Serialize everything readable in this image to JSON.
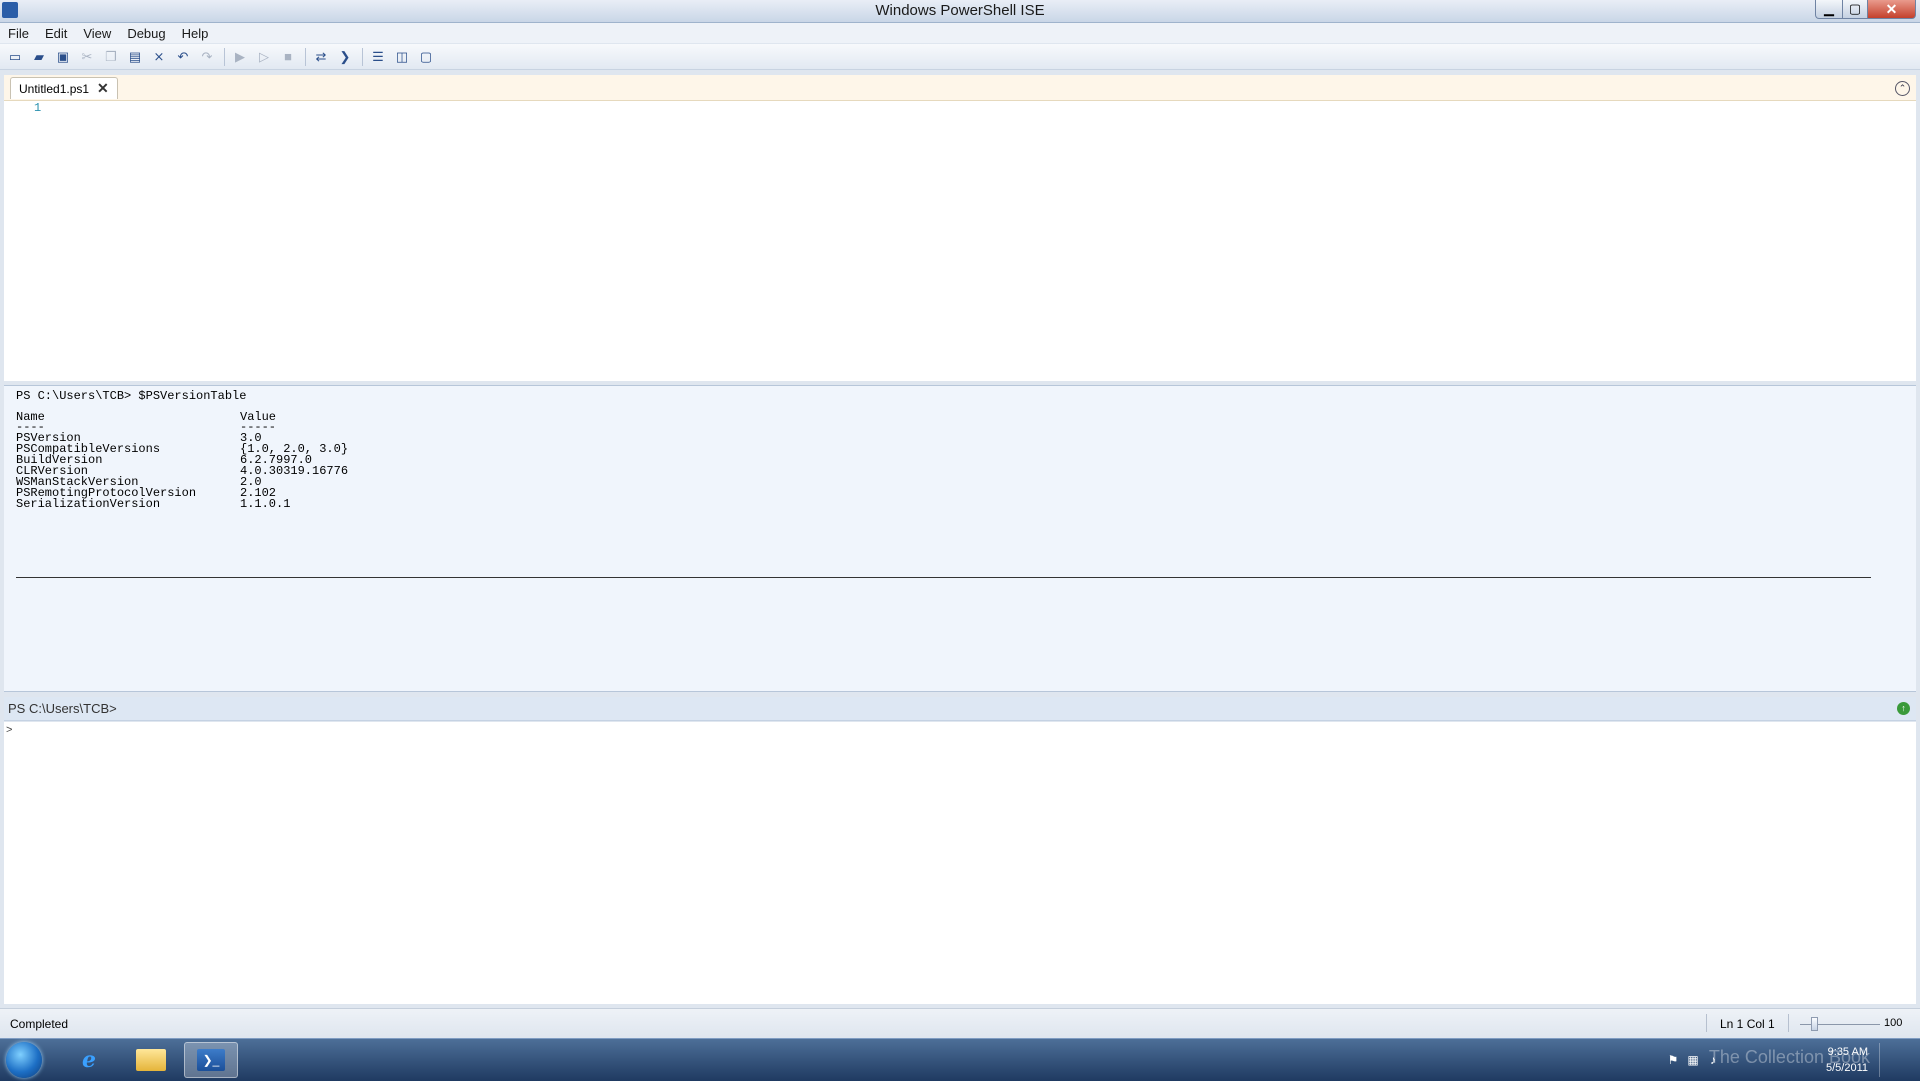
{
  "window": {
    "title": "Windows PowerShell ISE"
  },
  "menu": [
    "File",
    "Edit",
    "View",
    "Debug",
    "Help"
  ],
  "toolbar": {
    "icons": [
      "new-file-icon",
      "open-folder-icon",
      "save-icon",
      "cut-icon",
      "copy-icon",
      "paste-icon",
      "clear-icon",
      "undo-icon",
      "redo-icon",
      "run-icon",
      "run-selection-icon",
      "stop-icon",
      "remote-icon",
      "powershell-icon",
      "layout-top-icon",
      "layout-right-icon",
      "layout-max-icon"
    ]
  },
  "tab": {
    "label": "Untitled1.ps1",
    "close": "✕"
  },
  "editor": {
    "line_number": "1"
  },
  "output": {
    "command": "PS C:\\Users\\TCB> $PSVersionTable",
    "headers": [
      "Name",
      "Value"
    ],
    "underlines": [
      "----",
      "-----"
    ],
    "rows": [
      [
        "PSVersion",
        "3.0"
      ],
      [
        "PSCompatibleVersions",
        "{1.0, 2.0, 3.0}"
      ],
      [
        "BuildVersion",
        "6.2.7997.0"
      ],
      [
        "CLRVersion",
        "4.0.30319.16776"
      ],
      [
        "WSManStackVersion",
        "2.0"
      ],
      [
        "PSRemotingProtocolVersion",
        "2.102"
      ],
      [
        "SerializationVersion",
        "1.1.0.1"
      ]
    ]
  },
  "prompt": {
    "text": "PS C:\\Users\\TCB>"
  },
  "console": {
    "caret": ">"
  },
  "status": {
    "text": "Completed",
    "position": "Ln 1  Col 1",
    "zoom": "100"
  },
  "taskbar": {
    "clock_time": "9:35 AM",
    "clock_date": "5/5/2011",
    "watermark": "The Collection Book"
  }
}
